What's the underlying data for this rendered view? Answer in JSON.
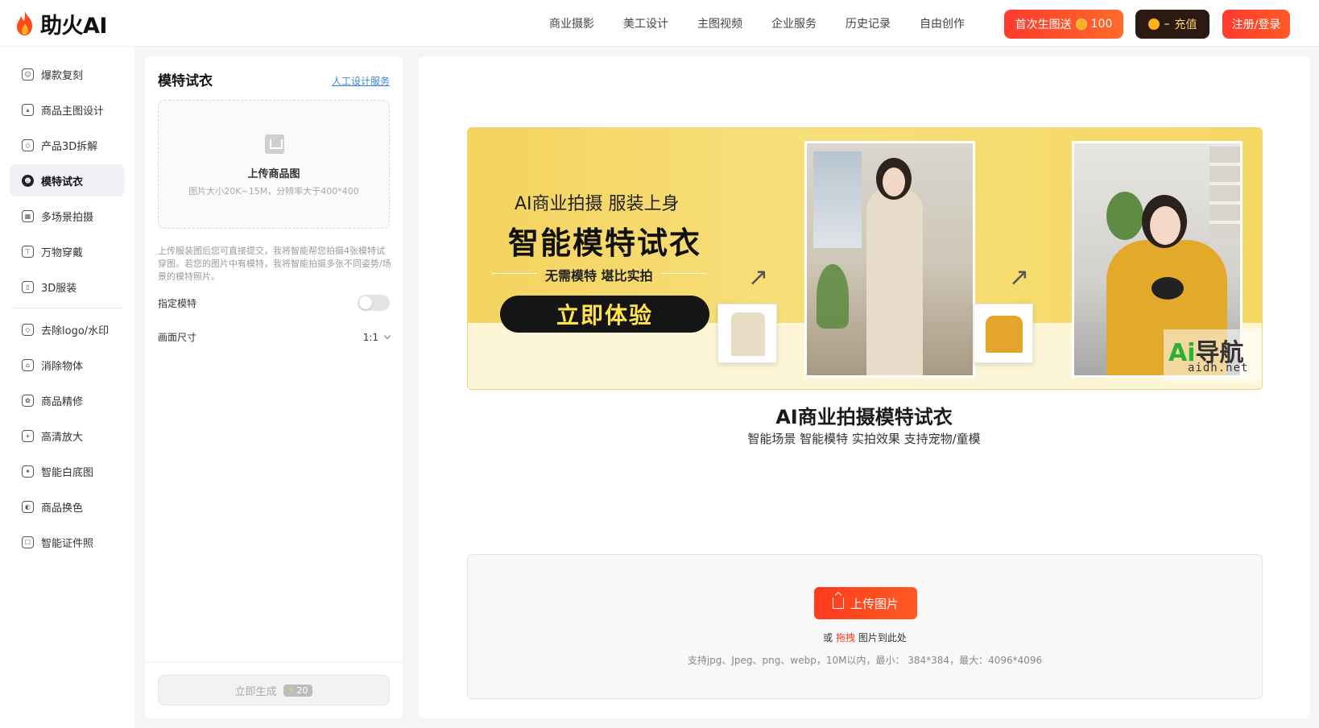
{
  "app": {
    "name": "助火AI"
  },
  "nav": [
    "商业摄影",
    "美工设计",
    "主图视频",
    "企业服务",
    "历史记录",
    "自由创作"
  ],
  "header": {
    "gift_label": "首次生图送",
    "gift_coins": "100",
    "balance": "–",
    "recharge_label": "充值",
    "login_label": "注册/登录",
    "accent": "#ff3a2e"
  },
  "sidebar": {
    "group1": [
      {
        "label": "爆款复刻",
        "icon": "smile-icon"
      },
      {
        "label": "商品主图设计",
        "icon": "image-icon"
      },
      {
        "label": "产品3D拆解",
        "icon": "eraser-icon"
      },
      {
        "label": "模特试衣",
        "icon": "face-icon",
        "active": true
      },
      {
        "label": "多场景拍摄",
        "icon": "calendar-icon"
      },
      {
        "label": "万物穿戴",
        "icon": "shirt-icon"
      },
      {
        "label": "3D服装",
        "icon": "phone-icon"
      }
    ],
    "group2": [
      {
        "label": "去除logo/水印",
        "icon": "eraser-icon"
      },
      {
        "label": "消除物体",
        "icon": "basket-icon"
      },
      {
        "label": "商品精修",
        "icon": "palette-icon"
      },
      {
        "label": "高清放大",
        "icon": "zoom-icon"
      },
      {
        "label": "智能白底图",
        "icon": "wand-icon"
      },
      {
        "label": "商品换色",
        "icon": "color-icon"
      },
      {
        "label": "智能证件照",
        "icon": "id-photo-icon"
      }
    ]
  },
  "panel": {
    "title": "模特试衣",
    "service_link": "人工设计服务",
    "upload_title": "上传商品图",
    "upload_hint": "图片大小20K~15M，分辨率大于400*400",
    "description": "上传服装图后您可直接提交，我将智能帮您拍摄4张模特试穿图。若您的图片中有模特，我将智能拍摄多张不同姿势/场景的模特照片。",
    "model_option": "指定模特",
    "size_option": "画面尺寸",
    "size_value": "1:1",
    "generate_label": "立即生成",
    "generate_cost": "20"
  },
  "banner": {
    "line1": "AI商业拍摄 服装上身",
    "line2": "智能模特试衣",
    "line3": "无需模特 堪比实拍",
    "cta": "立即体验",
    "watermark_top_ai": "Ai",
    "watermark_top_rest": "导航",
    "watermark_bottom": "aidh.net"
  },
  "main": {
    "title": "AI商业拍摄模特试衣",
    "subtitle": "智能场景 智能模特 实拍效果 支持宠物/童模",
    "upload_button": "上传图片",
    "or_text": "或",
    "drag_text": "拖拽",
    "drop_tail": "图片到此处",
    "formats_note": "支持jpg、Jpeg、png、webp，10M以内，最小： 384*384，最大：4096*4096"
  }
}
